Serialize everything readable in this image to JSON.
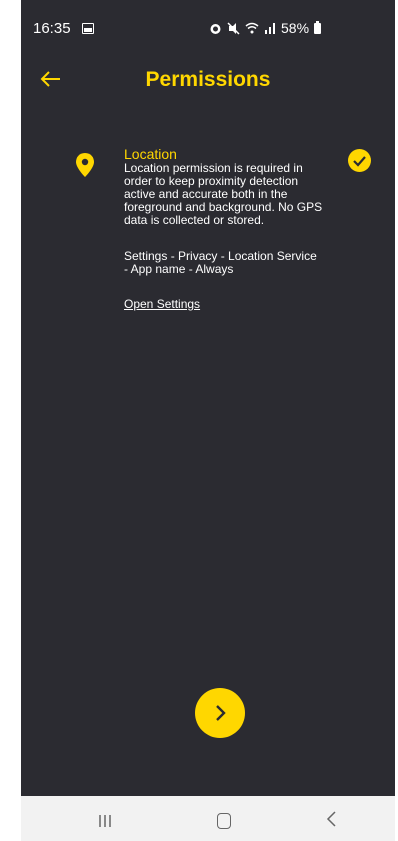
{
  "status_bar": {
    "time": "16:35",
    "battery": "58%",
    "icons": [
      "gallery-icon",
      "alarm-icon",
      "mute-icon",
      "wifi-icon",
      "signal-icon",
      "battery-icon"
    ]
  },
  "header": {
    "title": "Permissions",
    "back_icon": "arrow-left-icon"
  },
  "permission": {
    "title": "Location",
    "description": "Location permission is required in order to keep proximity detection active and accurate both in the foreground and background. No GPS data is collected or stored.",
    "path": "Settings - Privacy - Location Service - App name - Always",
    "link": "Open Settings",
    "granted": true,
    "icon": "location-pin-icon"
  },
  "next_button": {
    "icon": "chevron-right-icon"
  },
  "nav_bar": {
    "icons": [
      "recent-apps-icon",
      "home-icon",
      "back-icon"
    ]
  },
  "colors": {
    "accent": "#ffd700",
    "background": "#2b2b31",
    "nav": "#f2f2f2"
  }
}
